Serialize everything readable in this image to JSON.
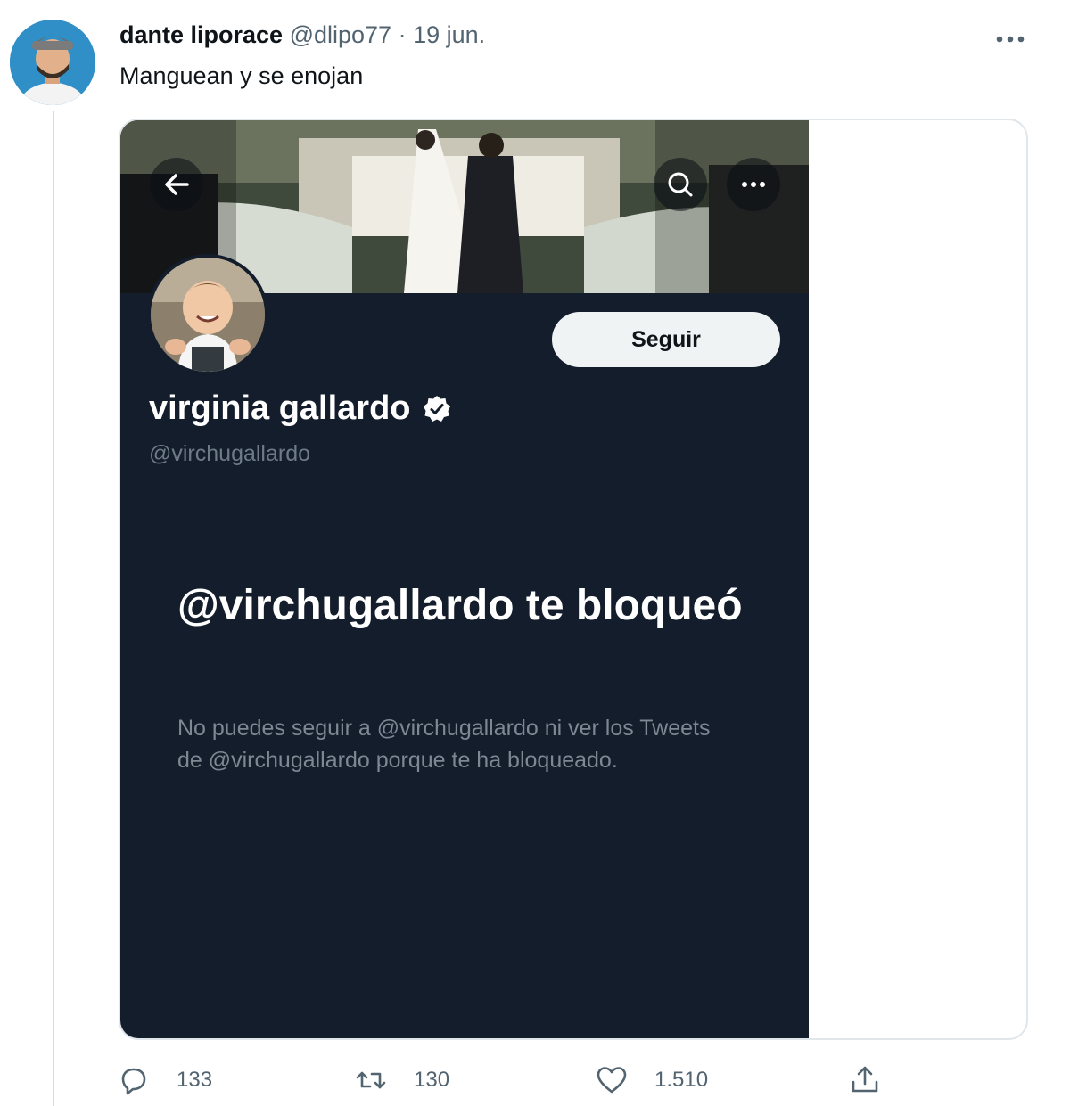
{
  "tweet": {
    "author_name": "dante liporace",
    "handle": "@dlipo77",
    "separator": "·",
    "date": "19 jun.",
    "text": "Manguean y se enojan"
  },
  "screenshot": {
    "profile_name": "virginia gallardo",
    "profile_handle": "@virchugallardo",
    "follow_label": "Seguir",
    "blocked_title": "@virchugallardo te bloqueó",
    "blocked_description": "No puedes seguir a @virchugallardo ni ver los Tweets de @virchugallardo porque te ha bloqueado.",
    "colors": {
      "background": "#141d2c",
      "follow_button": "#eff3f4"
    }
  },
  "actions": {
    "replies": "133",
    "retweets": "130",
    "likes": "1.510"
  },
  "icons": [
    "more-horizontal-icon",
    "back-arrow-icon",
    "search-icon",
    "verified-badge-icon",
    "reply-icon",
    "retweet-icon",
    "like-icon",
    "share-icon"
  ]
}
